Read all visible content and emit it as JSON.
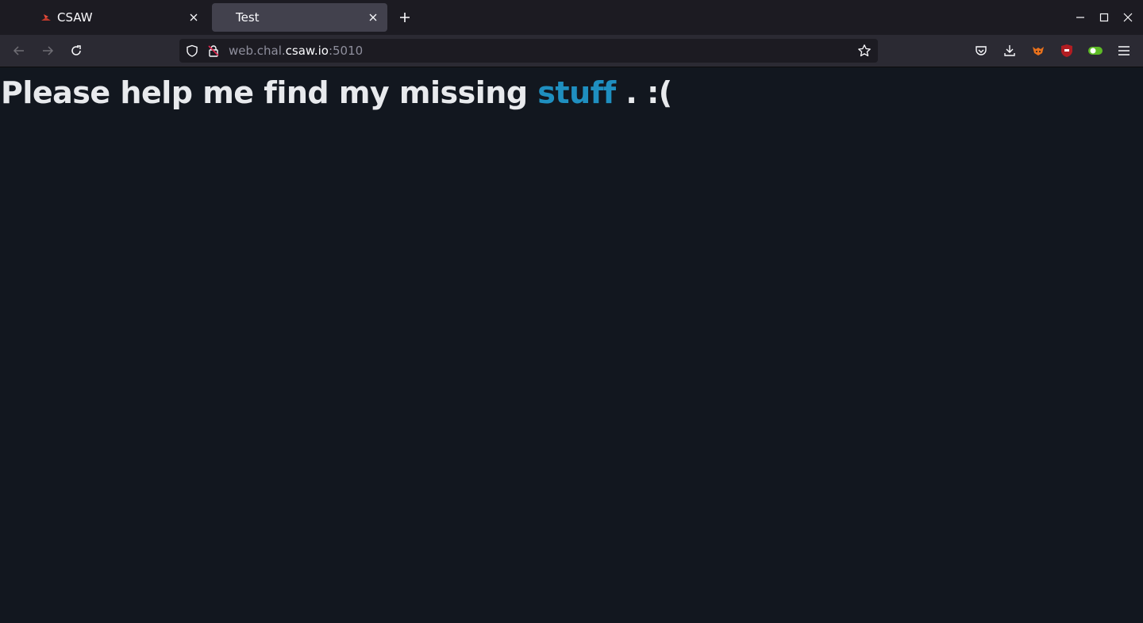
{
  "tabs": [
    {
      "title": "CSAW",
      "favicon": "csaw-logo-icon",
      "active": false
    },
    {
      "title": "Test",
      "favicon": "none",
      "active": true
    }
  ],
  "toolbar": {
    "url_prefix": "web.chal.",
    "url_host": "csaw.io",
    "url_suffix": ":5010"
  },
  "page": {
    "headline_before": "Please help me find my missing ",
    "headline_link": "stuff",
    "headline_after": " . :("
  },
  "colors": {
    "page_background": "#12171f",
    "link": "#1f8fc0",
    "ublock_red": "#b21d22",
    "toggle_green": "#5dbb25"
  }
}
